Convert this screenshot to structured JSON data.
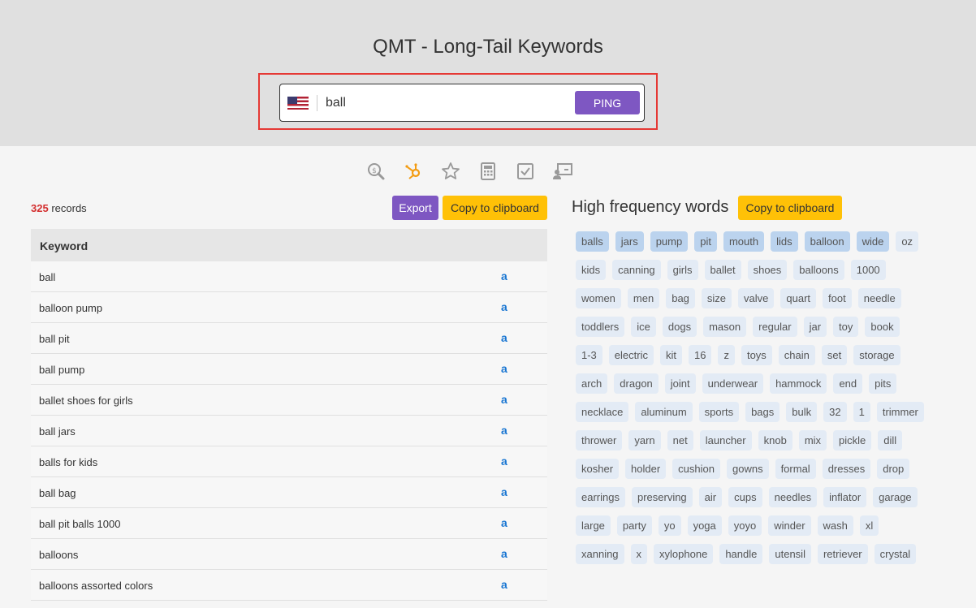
{
  "app": {
    "title": "QMT - Long-Tail Keywords"
  },
  "search": {
    "value": "ball",
    "ping_label": "PING"
  },
  "toolbar": {
    "icons": [
      "search-dollar-icon",
      "hubspot-icon",
      "star-icon",
      "calculator-icon",
      "checkbox-icon",
      "presentation-icon"
    ],
    "active_color": "#f39c12",
    "inactive_color": "#999999"
  },
  "records": {
    "count": "325",
    "label": "records"
  },
  "buttons": {
    "export": "Export",
    "copy": "Copy to clipboard"
  },
  "table": {
    "header": "Keyword",
    "amazon_icon": "a",
    "rows": [
      "ball",
      "balloon pump",
      "ball pit",
      "ball pump",
      "ballet shoes for girls",
      "ball jars",
      "balls for kids",
      "ball bag",
      "ball pit balls 1000",
      "balloons",
      "balloons assorted colors"
    ]
  },
  "high_freq": {
    "title": "High frequency words",
    "highlighted": [
      "balls",
      "jars",
      "pump",
      "pit",
      "mouth",
      "lids",
      "balloon",
      "wide"
    ],
    "words": [
      "balls",
      "jars",
      "pump",
      "pit",
      "mouth",
      "lids",
      "balloon",
      "wide",
      "oz",
      "kids",
      "canning",
      "girls",
      "ballet",
      "shoes",
      "balloons",
      "1000",
      "women",
      "men",
      "bag",
      "size",
      "valve",
      "quart",
      "foot",
      "needle",
      "toddlers",
      "ice",
      "dogs",
      "mason",
      "regular",
      "jar",
      "toy",
      "book",
      "1-3",
      "electric",
      "kit",
      "16",
      "z",
      "toys",
      "chain",
      "set",
      "storage",
      "arch",
      "dragon",
      "joint",
      "underwear",
      "hammock",
      "end",
      "pits",
      "necklace",
      "aluminum",
      "sports",
      "bags",
      "bulk",
      "32",
      "1",
      "trimmer",
      "thrower",
      "yarn",
      "net",
      "launcher",
      "knob",
      "mix",
      "pickle",
      "dill",
      "kosher",
      "holder",
      "cushion",
      "gowns",
      "formal",
      "dresses",
      "drop",
      "earrings",
      "preserving",
      "air",
      "cups",
      "needles",
      "inflator",
      "garage",
      "large",
      "party",
      "yo",
      "yoga",
      "yoyo",
      "winder",
      "wash",
      "xl",
      "xanning",
      "x",
      "xylophone",
      "handle",
      "utensil",
      "retriever",
      "crystal"
    ]
  },
  "colors": {
    "accent": "#7e57c2",
    "copy_button": "#ffc107",
    "record_count": "#d32f2f",
    "highlight_border": "#e53935"
  }
}
